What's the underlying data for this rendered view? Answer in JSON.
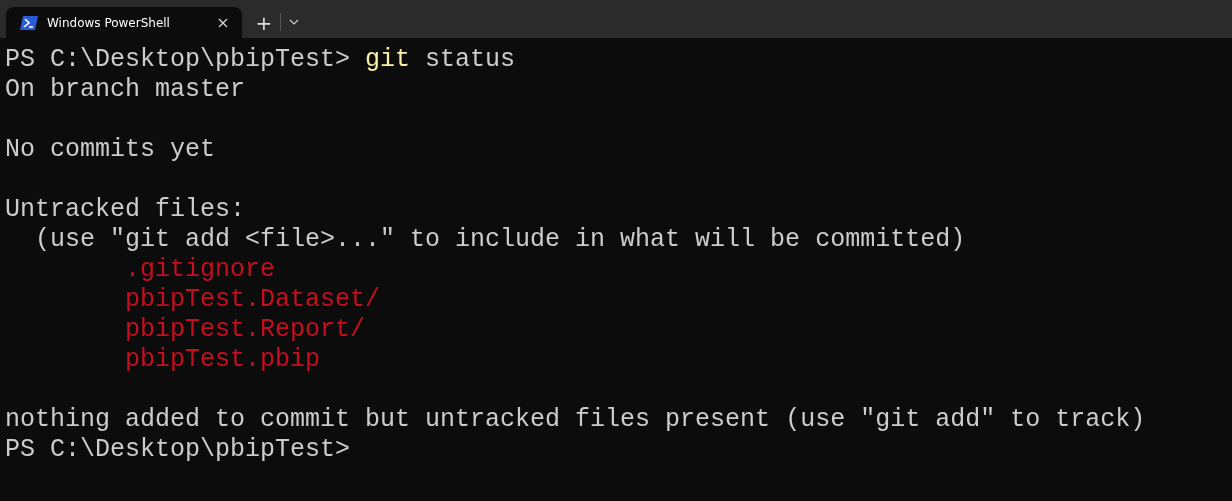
{
  "tab": {
    "title": "Windows PowerShell",
    "selected": true
  },
  "new_tab_button": "+",
  "lines": [
    {
      "kind": "command",
      "prompt": "PS C:\\Desktop\\pbipTest>",
      "command": "git",
      "args": "status"
    },
    {
      "kind": "plain",
      "text": "On branch master"
    },
    {
      "kind": "blank"
    },
    {
      "kind": "plain",
      "text": "No commits yet"
    },
    {
      "kind": "blank"
    },
    {
      "kind": "plain",
      "text": "Untracked files:"
    },
    {
      "kind": "hint",
      "text": "(use \"git add <file>...\" to include in what will be committed)"
    },
    {
      "kind": "untracked",
      "text": ".gitignore"
    },
    {
      "kind": "untracked",
      "text": "pbipTest.Dataset/"
    },
    {
      "kind": "untracked",
      "text": "pbipTest.Report/"
    },
    {
      "kind": "untracked",
      "text": "pbipTest.pbip"
    },
    {
      "kind": "blank"
    },
    {
      "kind": "plain",
      "text": "nothing added to commit but untracked files present (use \"git add\" to track)"
    },
    {
      "kind": "prompt",
      "prompt": "PS C:\\Desktop\\pbipTest>"
    }
  ]
}
